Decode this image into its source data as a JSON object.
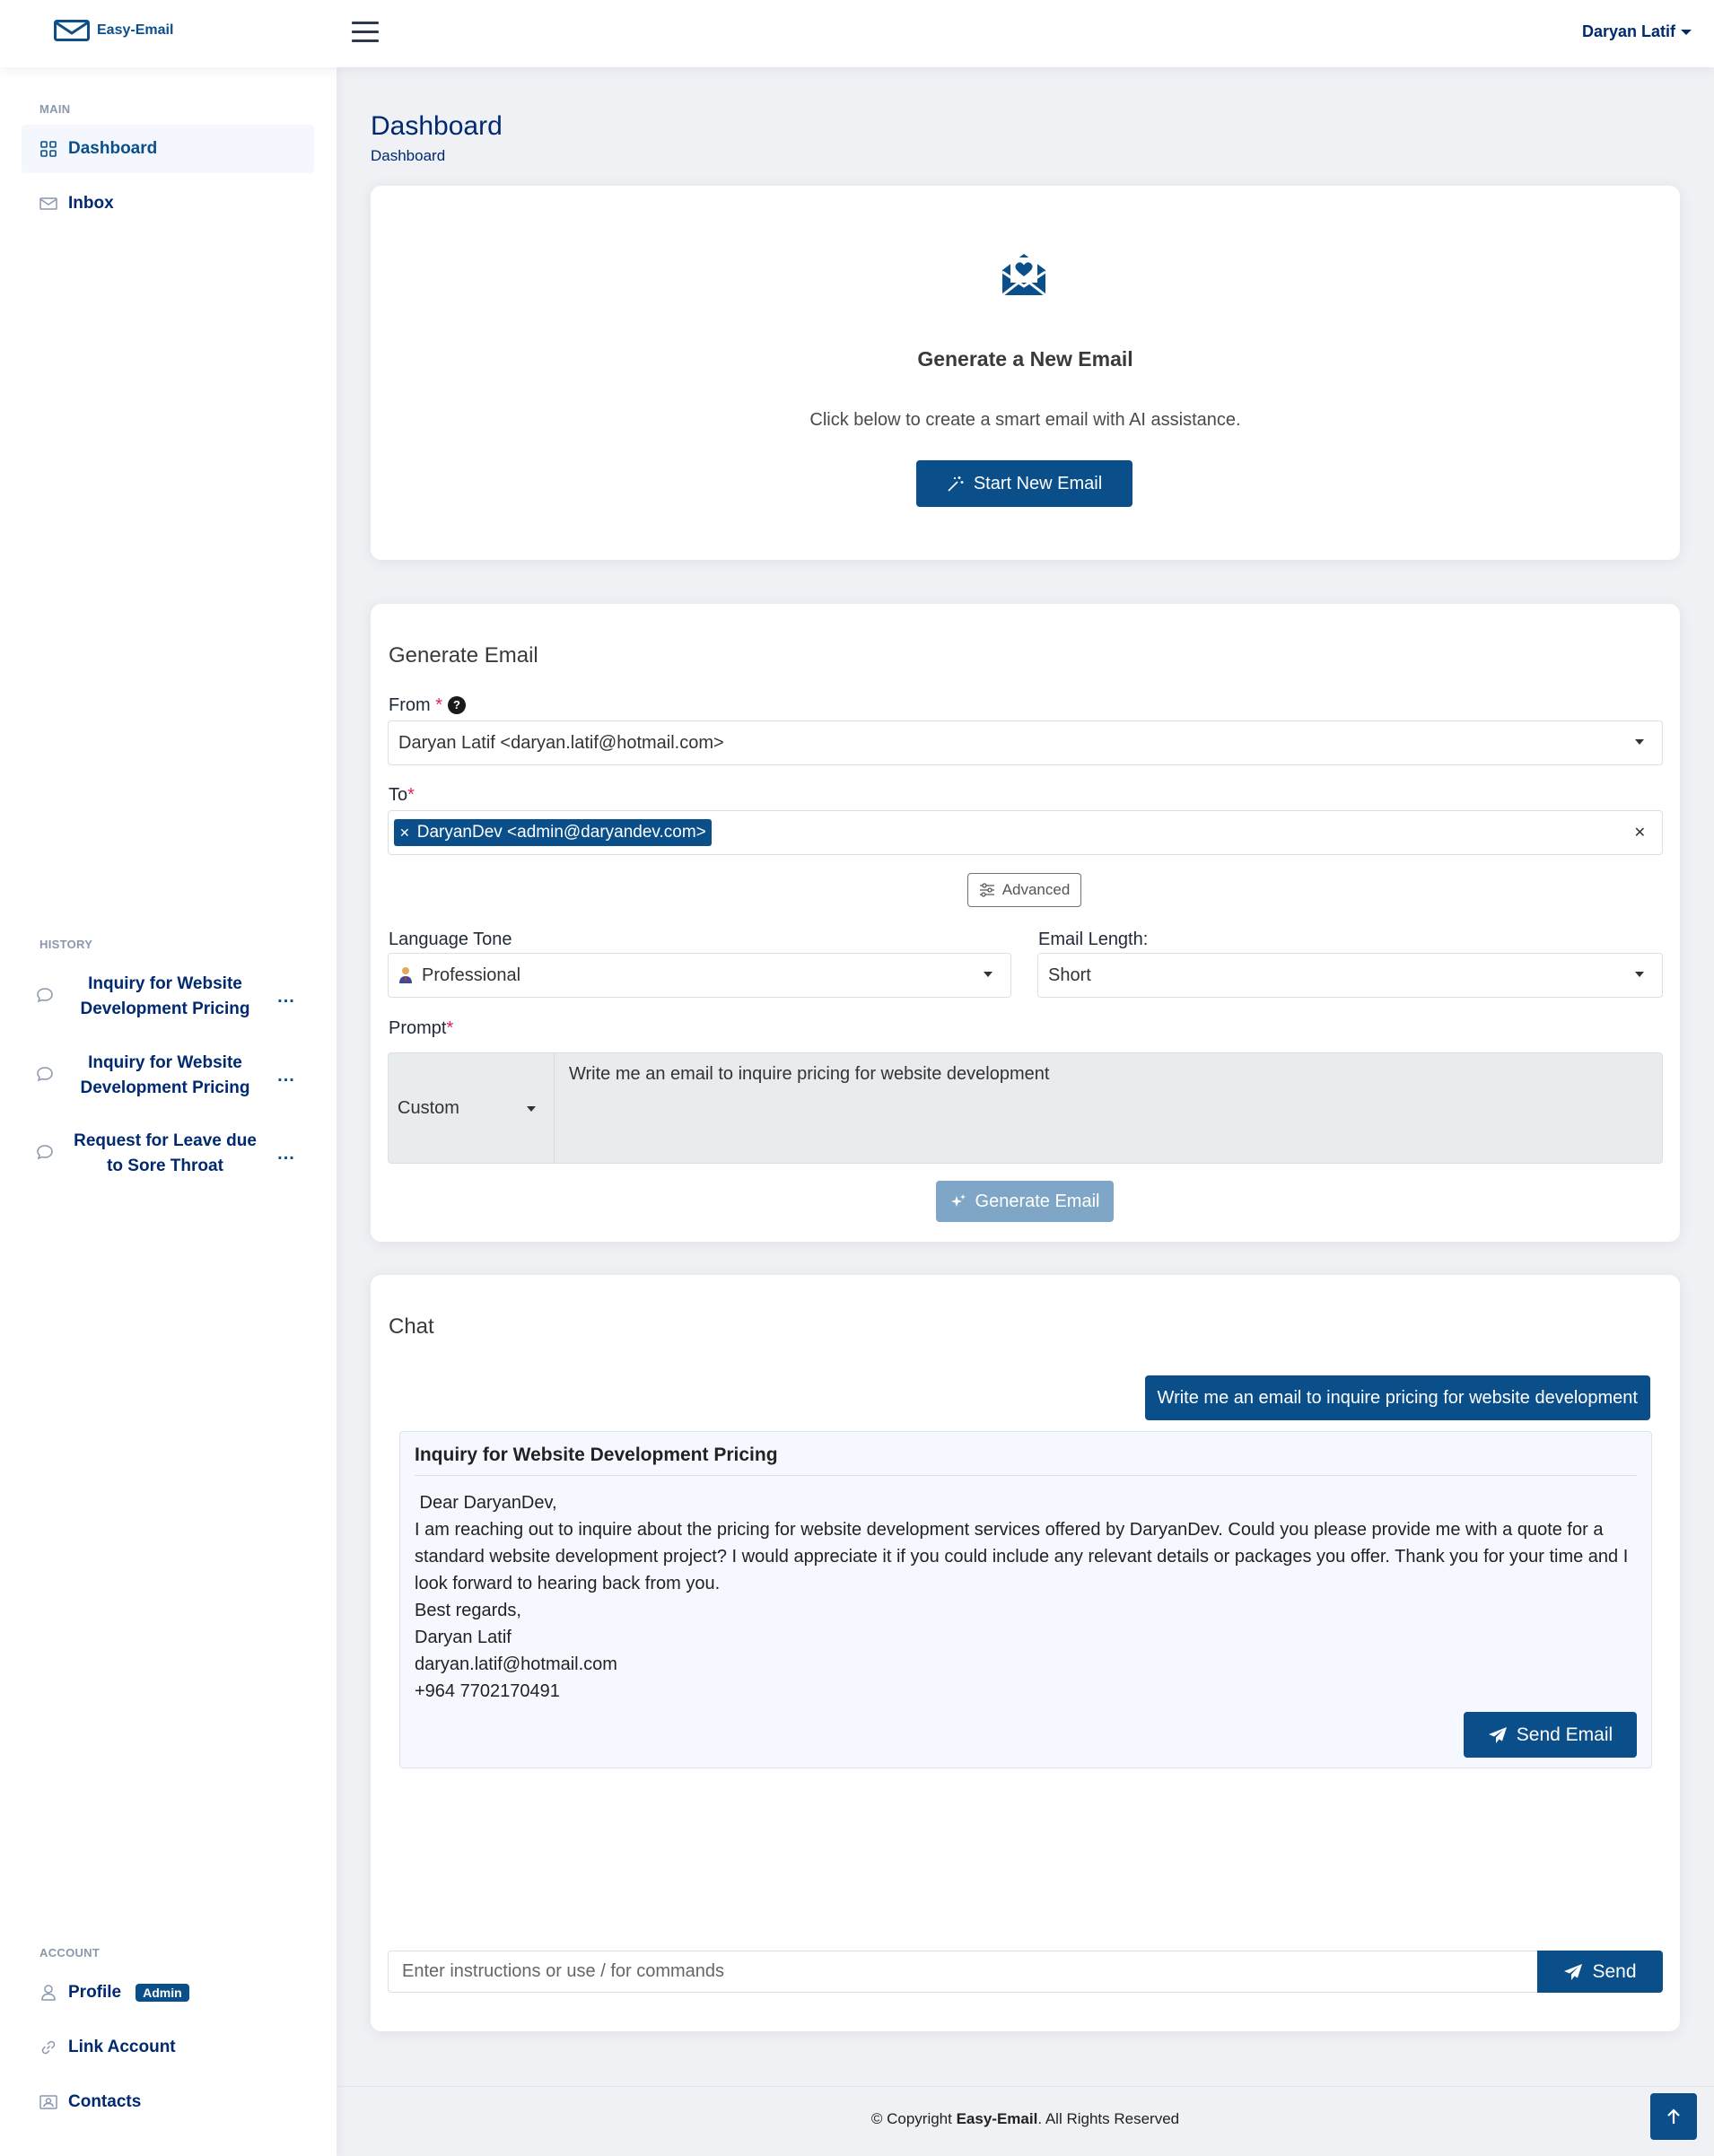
{
  "header": {
    "logo_text": "Easy-Email",
    "user_name": "Daryan Latif"
  },
  "sidebar": {
    "main_label": "MAIN",
    "items": [
      {
        "label": "Dashboard"
      },
      {
        "label": "Inbox"
      }
    ],
    "history_label": "HISTORY",
    "history": [
      {
        "line1": "Inquiry for Website",
        "line2": "Development Pricing"
      },
      {
        "line1": "Inquiry for Website",
        "line2": "Development Pricing"
      },
      {
        "line1": "Request for Leave due",
        "line2": "to Sore Throat"
      }
    ],
    "more_label": "...",
    "account_label": "ACCOUNT",
    "account_items": [
      {
        "label": "Profile"
      },
      {
        "label": "Link Account"
      },
      {
        "label": "Contacts"
      }
    ],
    "profile_badge": "Admin"
  },
  "page": {
    "title": "Dashboard",
    "breadcrumb": "Dashboard"
  },
  "hero": {
    "title": "Generate a New Email",
    "subtitle": "Click below to create a smart email with AI assistance.",
    "button": "Start New Email"
  },
  "generate": {
    "title": "Generate Email",
    "from_label": "From",
    "from_value": "Daryan Latif <daryan.latif@hotmail.com>",
    "to_label": "To",
    "to_chip": "DaryanDev <admin@daryandev.com>",
    "advanced": "Advanced",
    "tone_label": "Language Tone",
    "tone_value": "Professional",
    "length_label": "Email Length:",
    "length_value": "Short",
    "prompt_label": "Prompt",
    "prompt_type": "Custom",
    "prompt_text": "Write me an email to inquire pricing for website development",
    "button": "Generate Email",
    "required_mark": "*",
    "help_mark": "?"
  },
  "chat": {
    "title": "Chat",
    "user_message": "Write me an email to inquire pricing for website development",
    "reply_title": "Inquiry for Website Development Pricing",
    "reply_lines": [
      " Dear DaryanDev,",
      "I am reaching out to inquire about the pricing for website development services offered by DaryanDev. Could you please provide me with a quote for a standard website development project? I would appreciate it if you could include any relevant details or packages you offer. Thank you for your time and I look forward to hearing back from you.",
      "Best regards,",
      "Daryan Latif",
      "daryan.latif@hotmail.com",
      "+964 7702170491"
    ],
    "send_email_button": "Send Email",
    "input_placeholder": "Enter instructions or use / for commands",
    "send_button": "Send"
  },
  "footer": {
    "prefix": "© Copyright ",
    "brand": "Easy-Email",
    "suffix": ". All Rights Reserved"
  },
  "colors": {
    "primary": "#0b4f8a",
    "navy": "#012970",
    "background": "#f0f1f4"
  }
}
